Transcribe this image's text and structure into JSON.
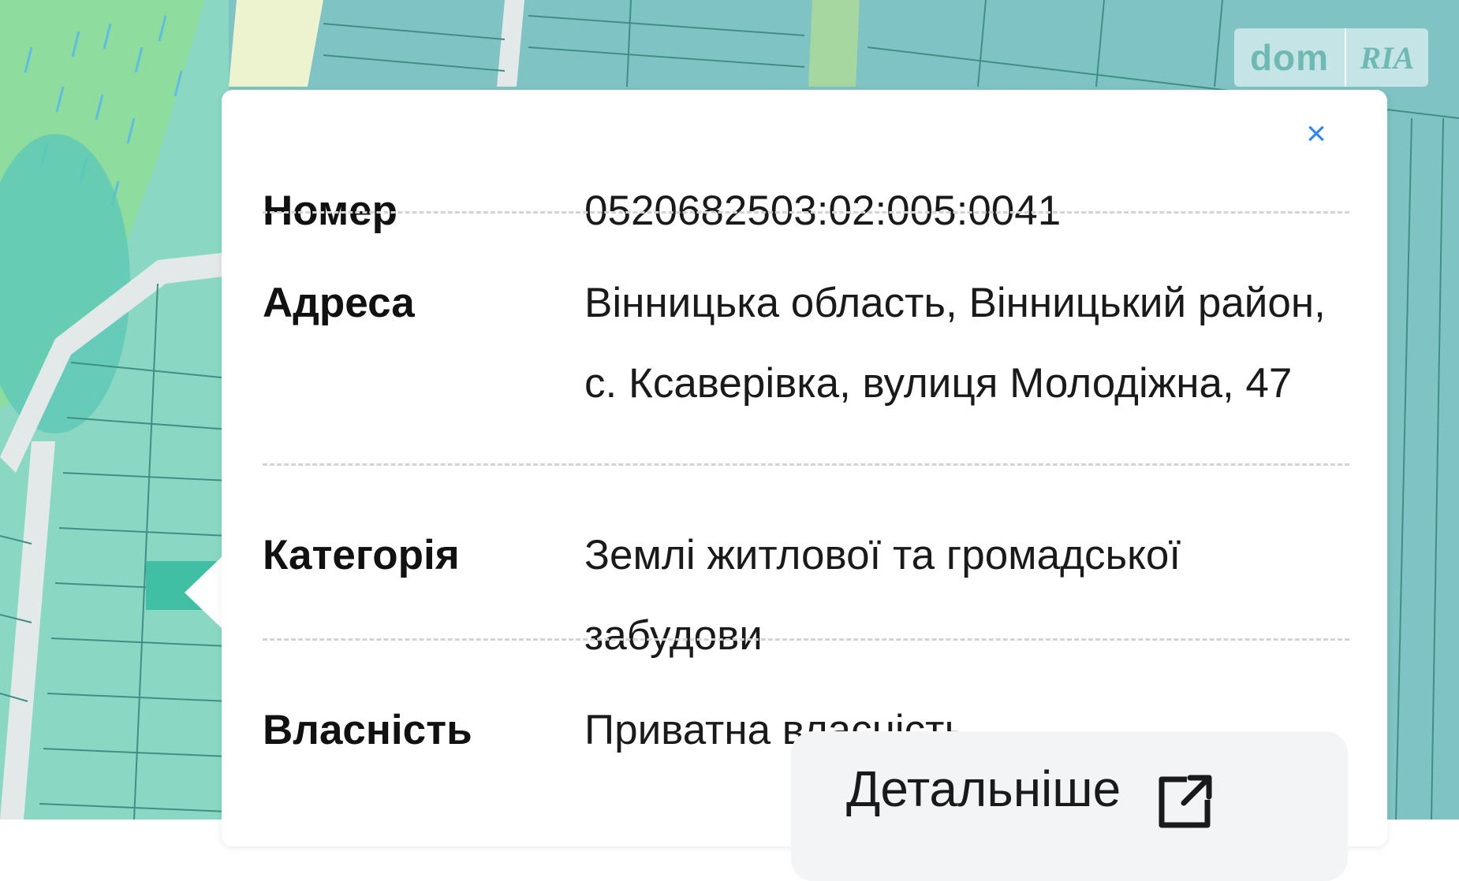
{
  "map": {
    "watermark": {
      "left": "dom",
      "right": "RIA"
    },
    "colors": {
      "parcel": "#8ad8c4",
      "parcel_alt": "#7fc3c5",
      "boundary": "#3f8f86",
      "road": "#e3e8e8",
      "forest": "#8fdc9f",
      "selected": "#41bfa4"
    }
  },
  "popup": {
    "close_icon": "close-icon",
    "rows": [
      {
        "label": "Номер",
        "value": "0520682503:02:005:0041"
      },
      {
        "label": "Адреса",
        "value": "Вінницька область, Вінницький район, с. Ксаверівка, вулиця Молодіжна, 47"
      },
      {
        "label": "Категорія",
        "value": "Землі житлової та громадської забудови"
      },
      {
        "label": "Власність",
        "value": "Приватна власність"
      }
    ],
    "details_button": {
      "label": "Детальніше",
      "icon": "external-link-icon"
    },
    "accent_color": "#2f86f6"
  }
}
